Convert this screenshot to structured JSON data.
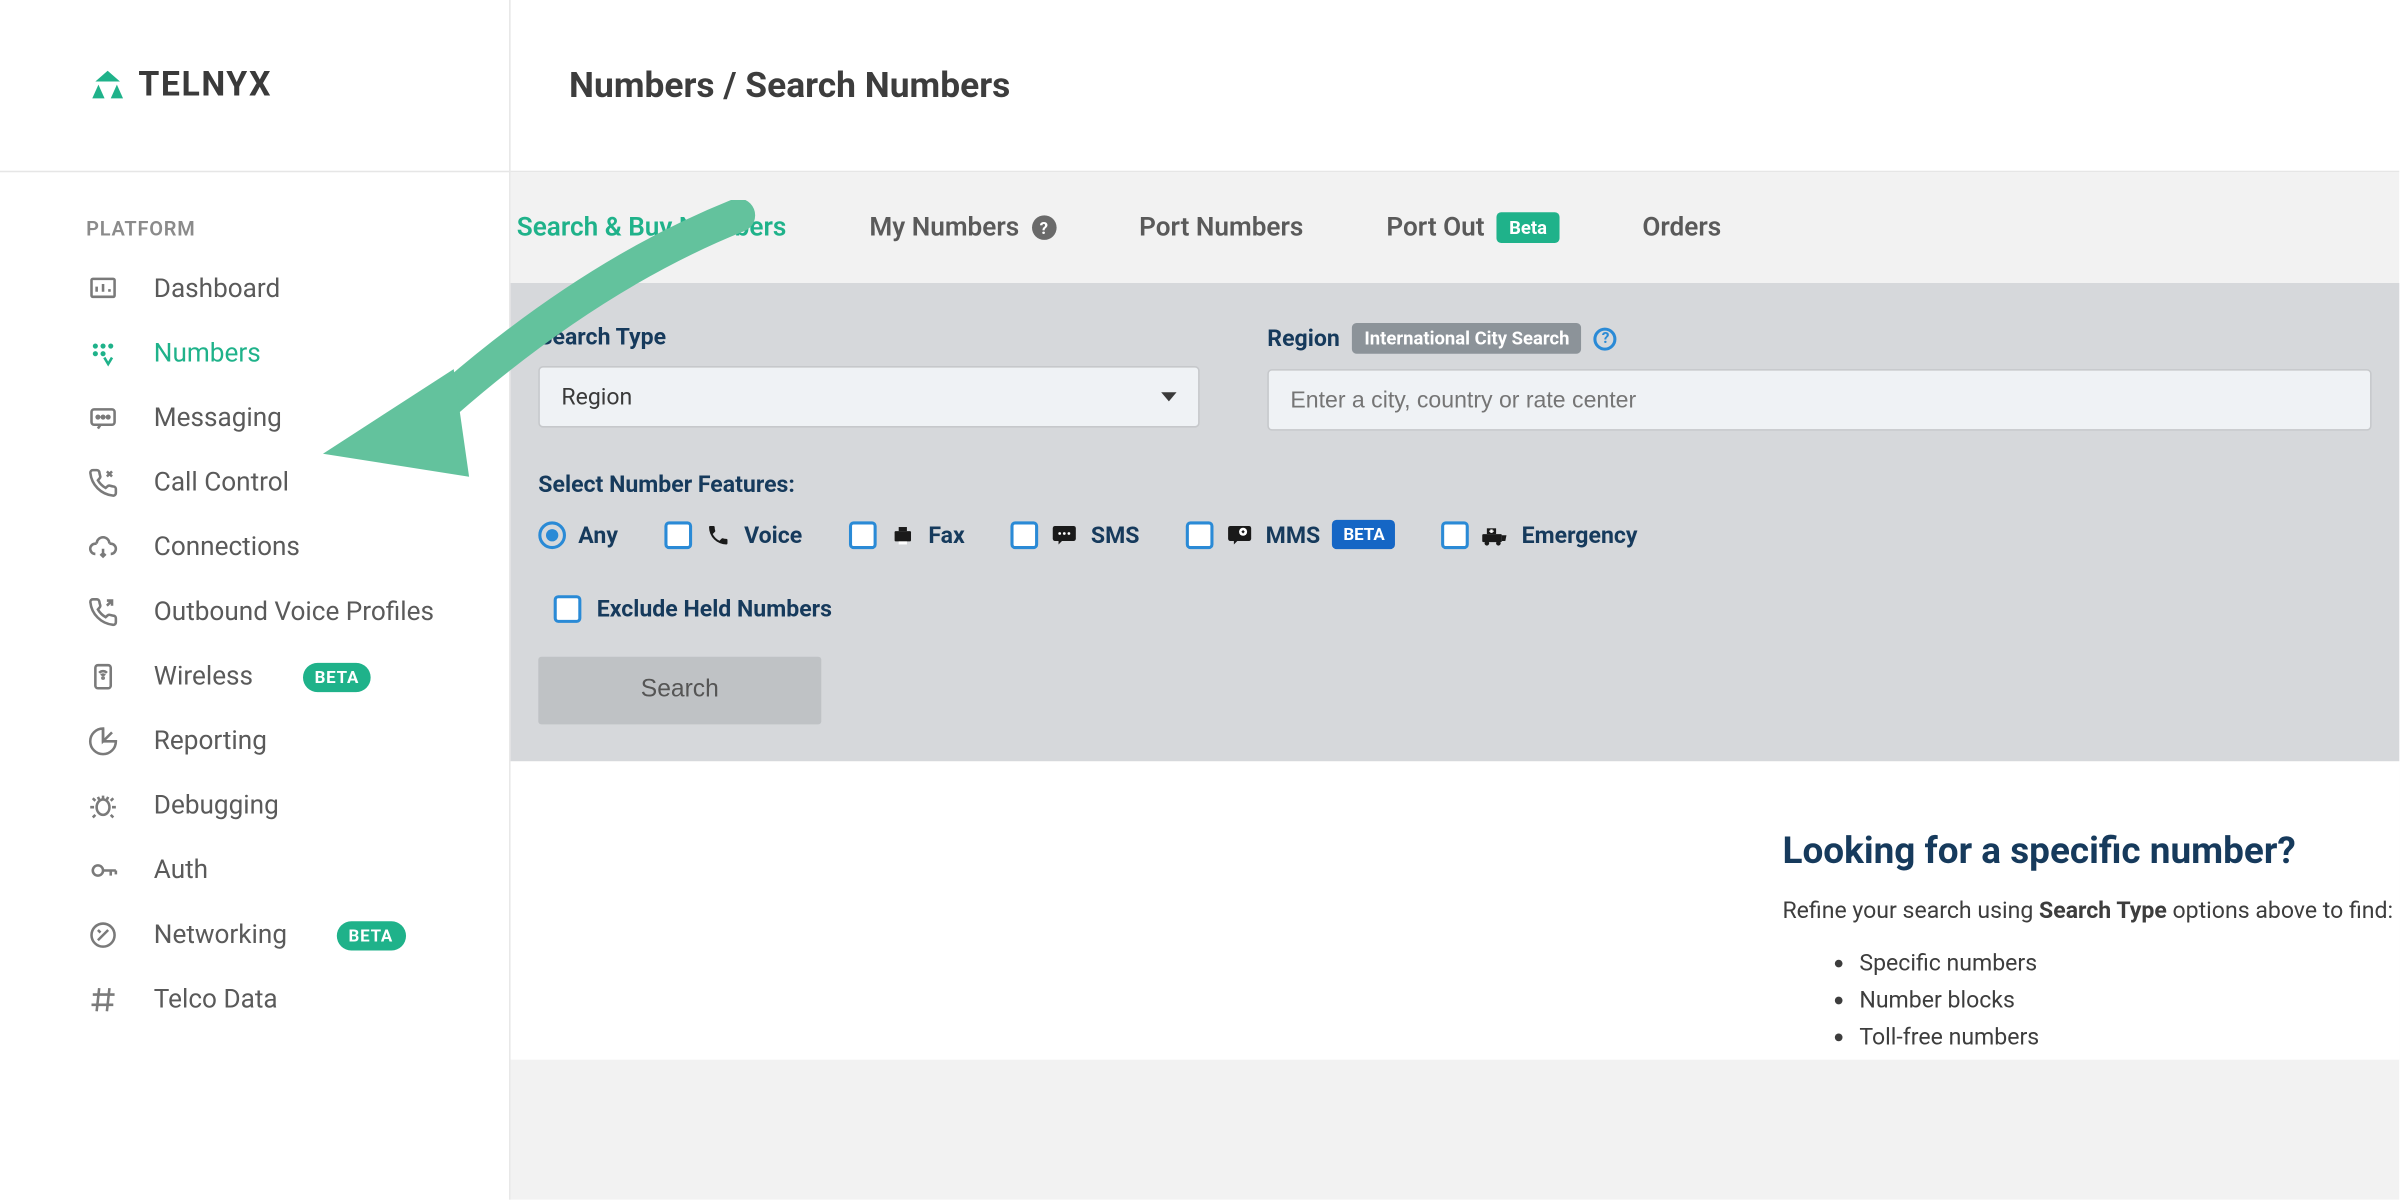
{
  "brand": "TELNYX",
  "sidebar": {
    "section_label": "PLATFORM",
    "items": [
      {
        "label": "Dashboard"
      },
      {
        "label": "Numbers"
      },
      {
        "label": "Messaging"
      },
      {
        "label": "Call Control"
      },
      {
        "label": "Connections"
      },
      {
        "label": "Outbound Voice Profiles"
      },
      {
        "label": "Wireless",
        "badge": "BETA"
      },
      {
        "label": "Reporting"
      },
      {
        "label": "Debugging"
      },
      {
        "label": "Auth"
      },
      {
        "label": "Networking",
        "badge": "BETA"
      },
      {
        "label": "Telco Data"
      }
    ]
  },
  "header": {
    "breadcrumb": "Numbers / Search Numbers"
  },
  "tabs": {
    "search_buy": "Search & Buy Numbers",
    "my_numbers": "My Numbers",
    "port_numbers": "Port Numbers",
    "port_out": "Port Out",
    "port_out_badge": "Beta",
    "orders": "Orders"
  },
  "panel": {
    "search_type_label": "Search Type",
    "search_type_value": "Region",
    "region_label": "Region",
    "region_chip": "International City Search",
    "region_placeholder": "Enter a city, country or rate center",
    "features_label": "Select Number Features:",
    "features": {
      "any": "Any",
      "voice": "Voice",
      "fax": "Fax",
      "sms": "SMS",
      "mms": "MMS",
      "mms_badge": "BETA",
      "emergency": "Emergency"
    },
    "exclude_label": "Exclude Held Numbers",
    "search_button": "Search"
  },
  "info": {
    "title": "Looking for a specific number?",
    "sub_pre": "Refine your search using ",
    "sub_strong": "Search Type",
    "sub_post": " options above to find:",
    "bullets": [
      "Specific numbers",
      "Number blocks",
      "Toll-free numbers"
    ]
  }
}
